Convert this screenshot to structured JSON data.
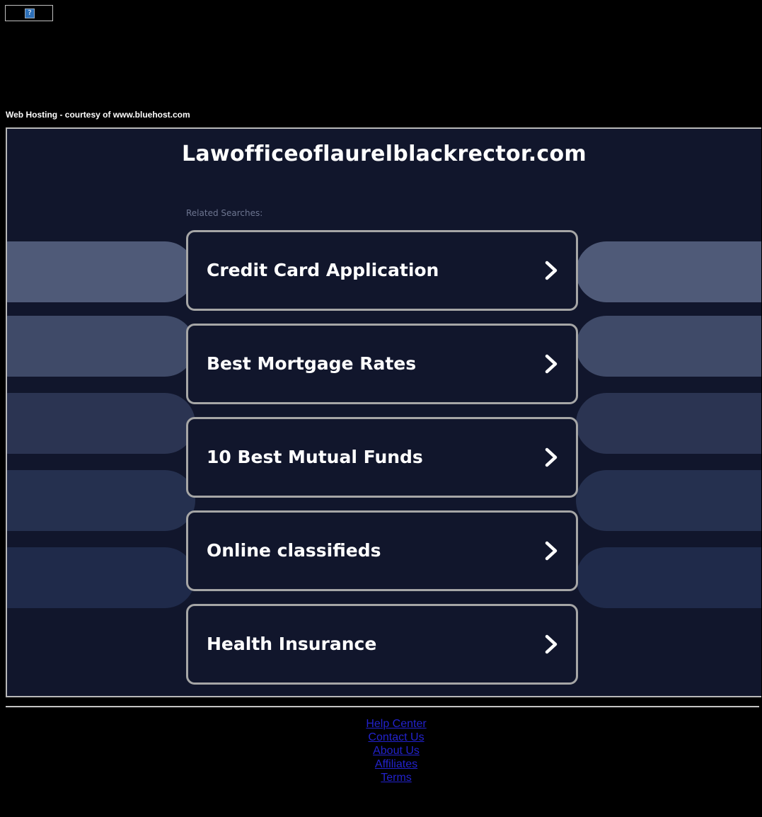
{
  "banner": {
    "icon_glyph": "?",
    "icon_name": "broken-image-icon"
  },
  "hosting_note": "Web Hosting - courtesy of www.bluehost.com",
  "site_title": "Lawofficeoflaurelblackrector.com",
  "related_label": "Related Searches:",
  "searches": [
    {
      "label": "Credit Card Application"
    },
    {
      "label": "Best Mortgage Rates"
    },
    {
      "label": "10 Best Mutual Funds"
    },
    {
      "label": "Online classifieds"
    },
    {
      "label": "Health Insurance"
    }
  ],
  "footer": {
    "links": [
      "Help Center",
      "Contact Us",
      "About Us",
      "Affiliates",
      "Terms"
    ]
  },
  "colors": {
    "page_background": "#000000",
    "panel_background": "#11162c",
    "button_border": "#a6a6a6",
    "link_color": "#2222cc",
    "pill_colors": [
      "#4f5a78",
      "#3f4a68",
      "#2b3452",
      "#25304f",
      "#1f2a4a"
    ]
  }
}
